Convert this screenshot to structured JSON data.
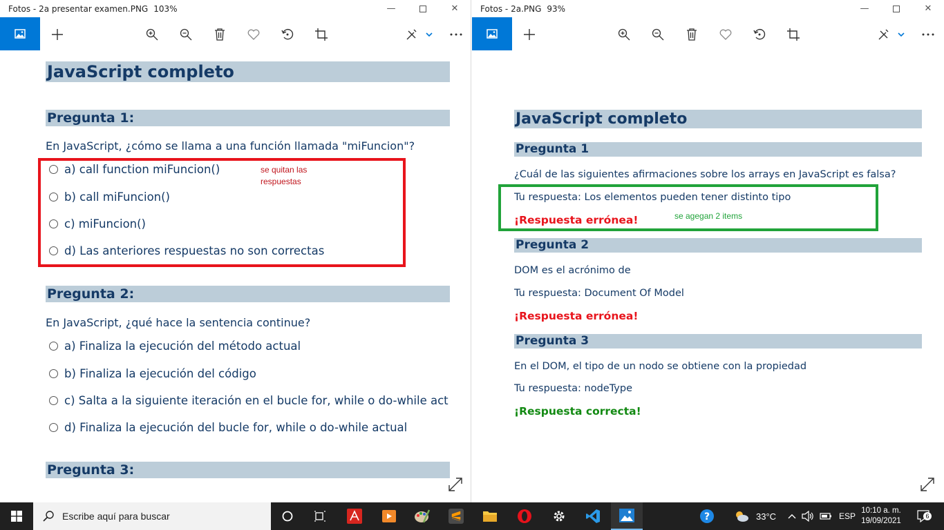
{
  "left_window": {
    "title": "Fotos - 2a presentar examen.PNG",
    "zoom": "103%",
    "doc": {
      "h1": "JavaScript completo",
      "q1": {
        "heading": "Pregunta 1:",
        "text": "En JavaScript, ¿cómo se llama a una función llamada \"miFuncion\"?",
        "options": [
          "a) call function miFuncion()",
          "b) call miFuncion()",
          "c) miFuncion()",
          "d) Las anteriores respuestas no son correctas"
        ]
      },
      "q2": {
        "heading": "Pregunta 2:",
        "text": "En JavaScript, ¿qué hace la sentencia continue?",
        "options": [
          "a) Finaliza la ejecución del método actual",
          "b) Finaliza la ejecución del código",
          "c) Salta a la siguiente iteración en el bucle for, while o do-while act",
          "d) Finaliza la ejecución del bucle for, while o do-while actual"
        ]
      },
      "q3": {
        "heading": "Pregunta 3:"
      }
    },
    "annotation": {
      "line1": "se quitan las",
      "line2": "respuestas",
      "color": "#e8141c"
    }
  },
  "right_window": {
    "title": "Fotos - 2a.PNG",
    "zoom": "93%",
    "doc": {
      "h1": "JavaScript completo",
      "q1": {
        "heading": "Pregunta 1",
        "text": "¿Cuál de las siguientes afirmaciones sobre los arrays en JavaScript es falsa?",
        "answer": "Tu respuesta: Los elementos pueden tener distinto tipo",
        "result": "¡Respuesta errónea!"
      },
      "q2": {
        "heading": "Pregunta 2",
        "text": "DOM es el acrónimo de",
        "answer": "Tu respuesta: Document Of Model",
        "result": "¡Respuesta errónea!"
      },
      "q3": {
        "heading": "Pregunta 3",
        "text": "En el DOM, el tipo de un nodo se obtiene con la propiedad",
        "answer": "Tu respuesta: nodeType",
        "result": "¡Respuesta correcta!"
      }
    },
    "annotation": {
      "text": "se agegan 2 items",
      "color": "#21a33a"
    }
  },
  "taskbar": {
    "search_placeholder": "Escribe aquí para buscar",
    "temperature": "33°C",
    "language": "ESP",
    "time": "10:10 a. m.",
    "date": "19/09/2021",
    "notifications": "6"
  },
  "colors": {
    "accent": "#0078d7",
    "heading_bg": "#bccdd9",
    "text": "#153a66",
    "wrong": "#e8141c",
    "correct": "#138a13"
  }
}
